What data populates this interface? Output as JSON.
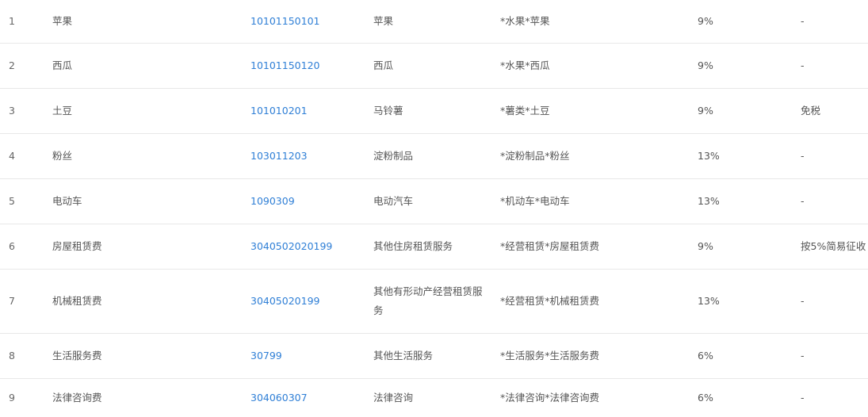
{
  "rows": [
    {
      "index": "1",
      "name": "苹果",
      "code": "10101150101",
      "category": "苹果",
      "short_name": "*水果*苹果",
      "tax_rate": "9%",
      "preference": "-"
    },
    {
      "index": "2",
      "name": "西瓜",
      "code": "10101150120",
      "category": "西瓜",
      "short_name": "*水果*西瓜",
      "tax_rate": "9%",
      "preference": "-"
    },
    {
      "index": "3",
      "name": "土豆",
      "code": "101010201",
      "category": "马铃薯",
      "short_name": "*薯类*土豆",
      "tax_rate": "9%",
      "preference": "免税"
    },
    {
      "index": "4",
      "name": "粉丝",
      "code": "103011203",
      "category": "淀粉制品",
      "short_name": "*淀粉制品*粉丝",
      "tax_rate": "13%",
      "preference": "-"
    },
    {
      "index": "5",
      "name": "电动车",
      "code": "1090309",
      "category": "电动汽车",
      "short_name": "*机动车*电动车",
      "tax_rate": "13%",
      "preference": "-"
    },
    {
      "index": "6",
      "name": "房屋租赁费",
      "code": "3040502020199",
      "category": "其他住房租赁服务",
      "short_name": "*经营租赁*房屋租赁费",
      "tax_rate": "9%",
      "preference": "按5%简易征收"
    },
    {
      "index": "7",
      "name": "机械租赁费",
      "code": "30405020199",
      "category": "其他有形动产经营租赁服务",
      "short_name": "*经营租赁*机械租赁费",
      "tax_rate": "13%",
      "preference": "-"
    },
    {
      "index": "8",
      "name": "生活服务费",
      "code": "30799",
      "category": "其他生活服务",
      "short_name": "*生活服务*生活服务费",
      "tax_rate": "6%",
      "preference": "-"
    },
    {
      "index": "9",
      "name": "法律咨询费",
      "code": "304060307",
      "category": "法律咨询",
      "short_name": "*法律咨询*法律咨询费",
      "tax_rate": "6%",
      "preference": "-"
    }
  ]
}
